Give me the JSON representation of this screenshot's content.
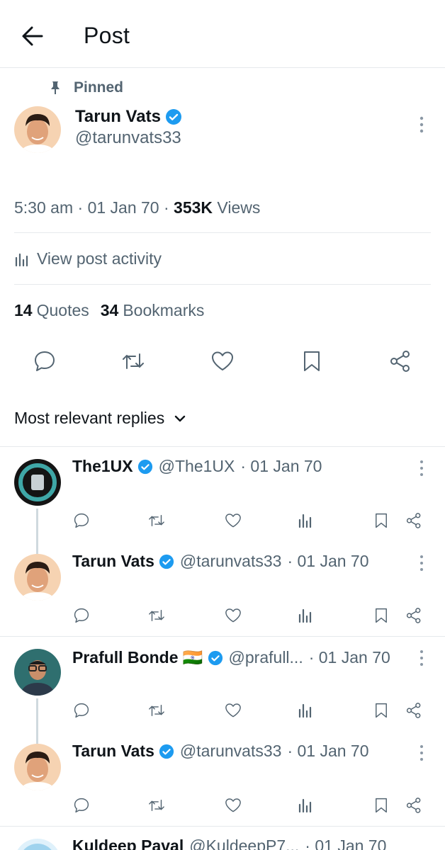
{
  "header": {
    "title": "Post",
    "back_icon": "arrow-left-icon"
  },
  "post": {
    "pinned_label": "Pinned",
    "author_name": "Tarun Vats",
    "author_handle": "@tarunvats33",
    "verified": true,
    "time": "5:30 am",
    "date": "01 Jan 70",
    "views_count": "353K",
    "views_label": "Views",
    "view_activity_label": "View post activity",
    "quotes_count": "14",
    "quotes_label": "Quotes",
    "bookmarks_count": "34",
    "bookmarks_label": "Bookmarks",
    "actions": [
      "reply-icon",
      "repost-icon",
      "like-icon",
      "bookmark-icon",
      "share-icon"
    ]
  },
  "replies_sort": {
    "label": "Most relevant replies"
  },
  "replies": [
    {
      "name": "The1UX",
      "handle": "@The1UX",
      "date": "· 01 Jan 70"
    },
    {
      "name": "Tarun Vats",
      "handle": "@tarunvats33",
      "date": "· 01 Jan 70"
    },
    {
      "name": "Prafull Bonde 🇮🇳",
      "handle": "@prafull...",
      "date": "· 01 Jan 70"
    },
    {
      "name": "Tarun Vats",
      "handle": "@tarunvats33",
      "date": "· 01 Jan 70"
    },
    {
      "name": "Kuldeep Paval",
      "handle": "@KuldeepP7...",
      "date": "· 01 Jan 70"
    }
  ],
  "colors": {
    "accent": "#1d9bf0",
    "text": "#0f1419",
    "muted": "#536471",
    "divider": "#e6e9ec"
  }
}
